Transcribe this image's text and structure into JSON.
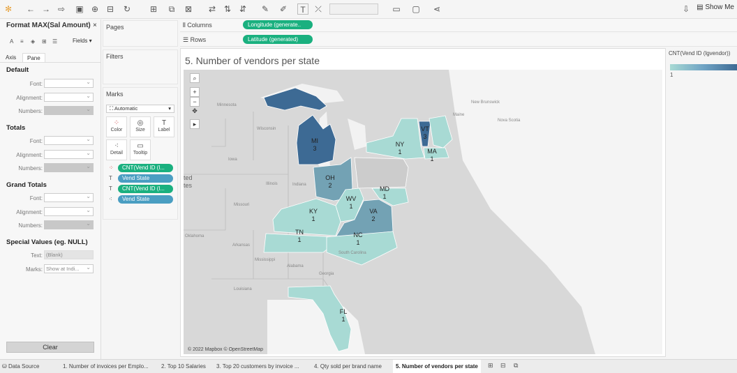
{
  "toolbar": {
    "show_me": "Show Me",
    "icons": [
      "tableau-logo-icon",
      "undo-icon",
      "redo-icon",
      "replay-icon",
      "save-icon",
      "new-datasource-icon",
      "pause-icon",
      "refresh-icon",
      "new-worksheet-icon",
      "duplicate-icon",
      "clear-icon",
      "swap-icon",
      "sort-asc-icon",
      "sort-desc-icon",
      "highlight-icon",
      "group-icon",
      "labels-icon",
      "fix-axes-icon",
      "fit-icon",
      "presentation-icon",
      "share-icon"
    ]
  },
  "format_pane": {
    "title": "Format MAX(Sal Amount)",
    "fields_label": "Fields ▾",
    "tabs": [
      "Axis",
      "Pane"
    ],
    "active_tab": "Pane",
    "sections": {
      "default": {
        "title": "Default",
        "font": "Font:",
        "alignment": "Alignment:",
        "numbers": "Numbers:"
      },
      "totals": {
        "title": "Totals",
        "font": "Font:",
        "alignment": "Alignment:",
        "numbers": "Numbers:"
      },
      "grand_totals": {
        "title": "Grand Totals",
        "font": "Font:",
        "alignment": "Alignment:",
        "numbers": "Numbers:"
      },
      "special": {
        "title": "Special Values (eg. NULL)",
        "text_label": "Text:",
        "text_value": "(Blank)",
        "marks_label": "Marks:",
        "marks_value": "Show at Indi..."
      }
    },
    "clear": "Clear"
  },
  "cards": {
    "pages": "Pages",
    "filters": "Filters",
    "marks": {
      "title": "Marks",
      "type": "Automatic",
      "buttons": [
        "Color",
        "Size",
        "Label",
        "Detail",
        "Tooltip"
      ],
      "pills": [
        {
          "text": "CNT(Vend ID (l...",
          "color": "green",
          "icon": "color-icon"
        },
        {
          "text": "Vend State",
          "color": "blue",
          "icon": "label-icon"
        },
        {
          "text": "CNT(Vend ID (l...",
          "color": "green",
          "icon": "label-icon"
        },
        {
          "text": "Vend State",
          "color": "blue",
          "icon": "detail-icon"
        }
      ]
    }
  },
  "shelves": {
    "columns_label": "Columns",
    "columns_pill": "Longitude (generate..",
    "rows_label": "Rows",
    "rows_pill": "Latitude (generated)"
  },
  "view": {
    "title": "5. Number of vendors per state",
    "copyright": "© 2022 Mapbox © OpenStreetMap",
    "map_labels": [
      "Minnesota",
      "Wisconsin",
      "Iowa",
      "Illinois",
      "Indiana",
      "Missouri",
      "Oklahoma",
      "Arkansas",
      "Mississippi",
      "Alabama",
      "Georgia",
      "Louisiana",
      "South Carolina",
      "Maine",
      "New Brunswick",
      "Nova Scotia"
    ],
    "edge_text": [
      "ted",
      "tes"
    ]
  },
  "chart_data": {
    "type": "map",
    "measure": "CNT(Vend ID (lgvendor))",
    "regions": [
      {
        "state": "MI",
        "value": 3
      },
      {
        "state": "VT",
        "value": 3
      },
      {
        "state": "NY",
        "value": 1
      },
      {
        "state": "MA",
        "value": 1
      },
      {
        "state": "OH",
        "value": 2
      },
      {
        "state": "MD",
        "value": 1
      },
      {
        "state": "WV",
        "value": 1
      },
      {
        "state": "KY",
        "value": 1
      },
      {
        "state": "VA",
        "value": 2
      },
      {
        "state": "TN",
        "value": 1
      },
      {
        "state": "NC",
        "value": 1
      },
      {
        "state": "FL",
        "value": 1
      }
    ],
    "color_scale": {
      "min": 1,
      "min_color": "#a8dad4",
      "max_color": "#3d6a94"
    }
  },
  "legend": {
    "title": "CNT(Vend ID (lgvendor))",
    "min_label": "1"
  },
  "tabs": [
    {
      "label": "Data Source",
      "active": false
    },
    {
      "label": "1. Number of invoices per Emplo...",
      "active": false
    },
    {
      "label": "2. Top 10 Salaries",
      "active": false
    },
    {
      "label": "3. Top 20 customers by invoice ...",
      "active": false
    },
    {
      "label": "4. Qty sold per brand name",
      "active": false
    },
    {
      "label": "5. Number of vendors per state",
      "active": true
    }
  ]
}
